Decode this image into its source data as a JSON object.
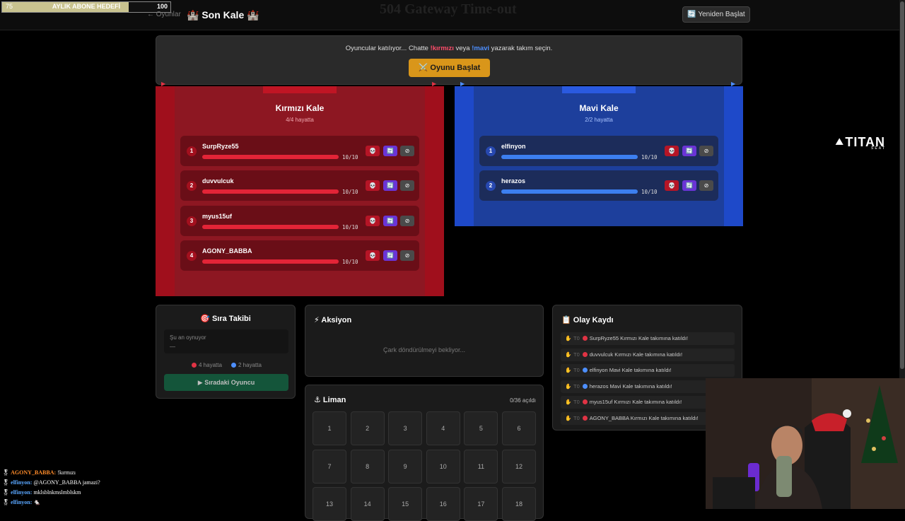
{
  "subgoal": {
    "current": "75",
    "label": "AYLIK ABONE HEDEFİ",
    "target": "100",
    "progress": 0.75
  },
  "header": {
    "back": "← Oyunlar",
    "title": "🏰 Son Kale 🏰",
    "error_text": "504 Gateway Time-out",
    "restart": "🔄 Yeniden Başlat"
  },
  "info": {
    "prefix": "Oyuncular katılıyor... Chatte ",
    "red_cmd": "!kırmızı",
    "mid": " veya ",
    "blue_cmd": "!mavi",
    "suffix": " yazarak takım seçin.",
    "start": "⚔️ Oyunu Başlat"
  },
  "teams": {
    "red": {
      "name": "Kırmızı Kale",
      "status": "4/4 hayatta",
      "players": [
        {
          "num": "1",
          "name": "SurpRyze55",
          "hp": "10/10"
        },
        {
          "num": "2",
          "name": "duvvulcuk",
          "hp": "10/10"
        },
        {
          "num": "3",
          "name": "myus15uf",
          "hp": "10/10"
        },
        {
          "num": "4",
          "name": "AGONY_BABBA",
          "hp": "10/10"
        }
      ]
    },
    "blue": {
      "name": "Mavi Kale",
      "status": "2/2 hayatta",
      "players": [
        {
          "num": "1",
          "name": "elfinyon",
          "hp": "10/10"
        },
        {
          "num": "2",
          "name": "herazos",
          "hp": "10/10"
        }
      ]
    }
  },
  "actions": {
    "kill": "💀",
    "swap": "🔄",
    "ban": "⊘"
  },
  "turn": {
    "title": "🎯 Sıra Takibi",
    "now_label": "Şu an oynuyor",
    "now_value": "—",
    "red_alive": "4 hayatta",
    "blue_alive": "2 hayatta",
    "next": "▶ Sıradaki Oyuncu"
  },
  "action": {
    "title": "⚡ Aksiyon",
    "waiting": "Çark döndürülmeyi bekliyor..."
  },
  "harbor": {
    "title": "⚓ Liman",
    "opened": "0/36 açıldı",
    "cells": [
      "1",
      "2",
      "3",
      "4",
      "5",
      "6",
      "7",
      "8",
      "9",
      "10",
      "11",
      "12",
      "13",
      "14",
      "15",
      "16",
      "17",
      "18"
    ]
  },
  "log": {
    "title": "📋 Olay Kaydı",
    "entries": [
      {
        "time": "T0",
        "team": "red",
        "text": "SurpRyze55 Kırmızı Kale takımına katıldı!"
      },
      {
        "time": "T0",
        "team": "red",
        "text": "duvvulcuk Kırmızı Kale takımına katıldı!"
      },
      {
        "time": "T0",
        "team": "blue",
        "text": "elfinyon Mavi Kale takımına katıldı!"
      },
      {
        "time": "T0",
        "team": "blue",
        "text": "herazos Mavi Kale takımına katıldı!"
      },
      {
        "time": "T0",
        "team": "red",
        "text": "myus15uf Kırmızı Kale takımına katıldı!"
      },
      {
        "time": "T0",
        "team": "red",
        "text": "AGONY_BABBA Kırmızı Kale takımına katıldı!"
      }
    ]
  },
  "brand": {
    "name": "TITAN",
    "sub": "SEAT"
  },
  "chat": [
    {
      "user": "AGONY_BABBA:",
      "msg": " !kırmızı",
      "team": "red"
    },
    {
      "user": "elfinyon:",
      "msg": " @AGONY_BABBA jamazi?",
      "team": "blue"
    },
    {
      "user": "elfinyon:",
      "msg": " mklsblnkmslmblskm",
      "team": "blue"
    },
    {
      "user": "elfinyon:",
      "msg": " 🐁",
      "team": "blue"
    }
  ],
  "colors": {
    "red_team": "#e32437",
    "blue_team": "#3c7ff0",
    "accent": "#d9961a",
    "next_button": "#14553a"
  }
}
